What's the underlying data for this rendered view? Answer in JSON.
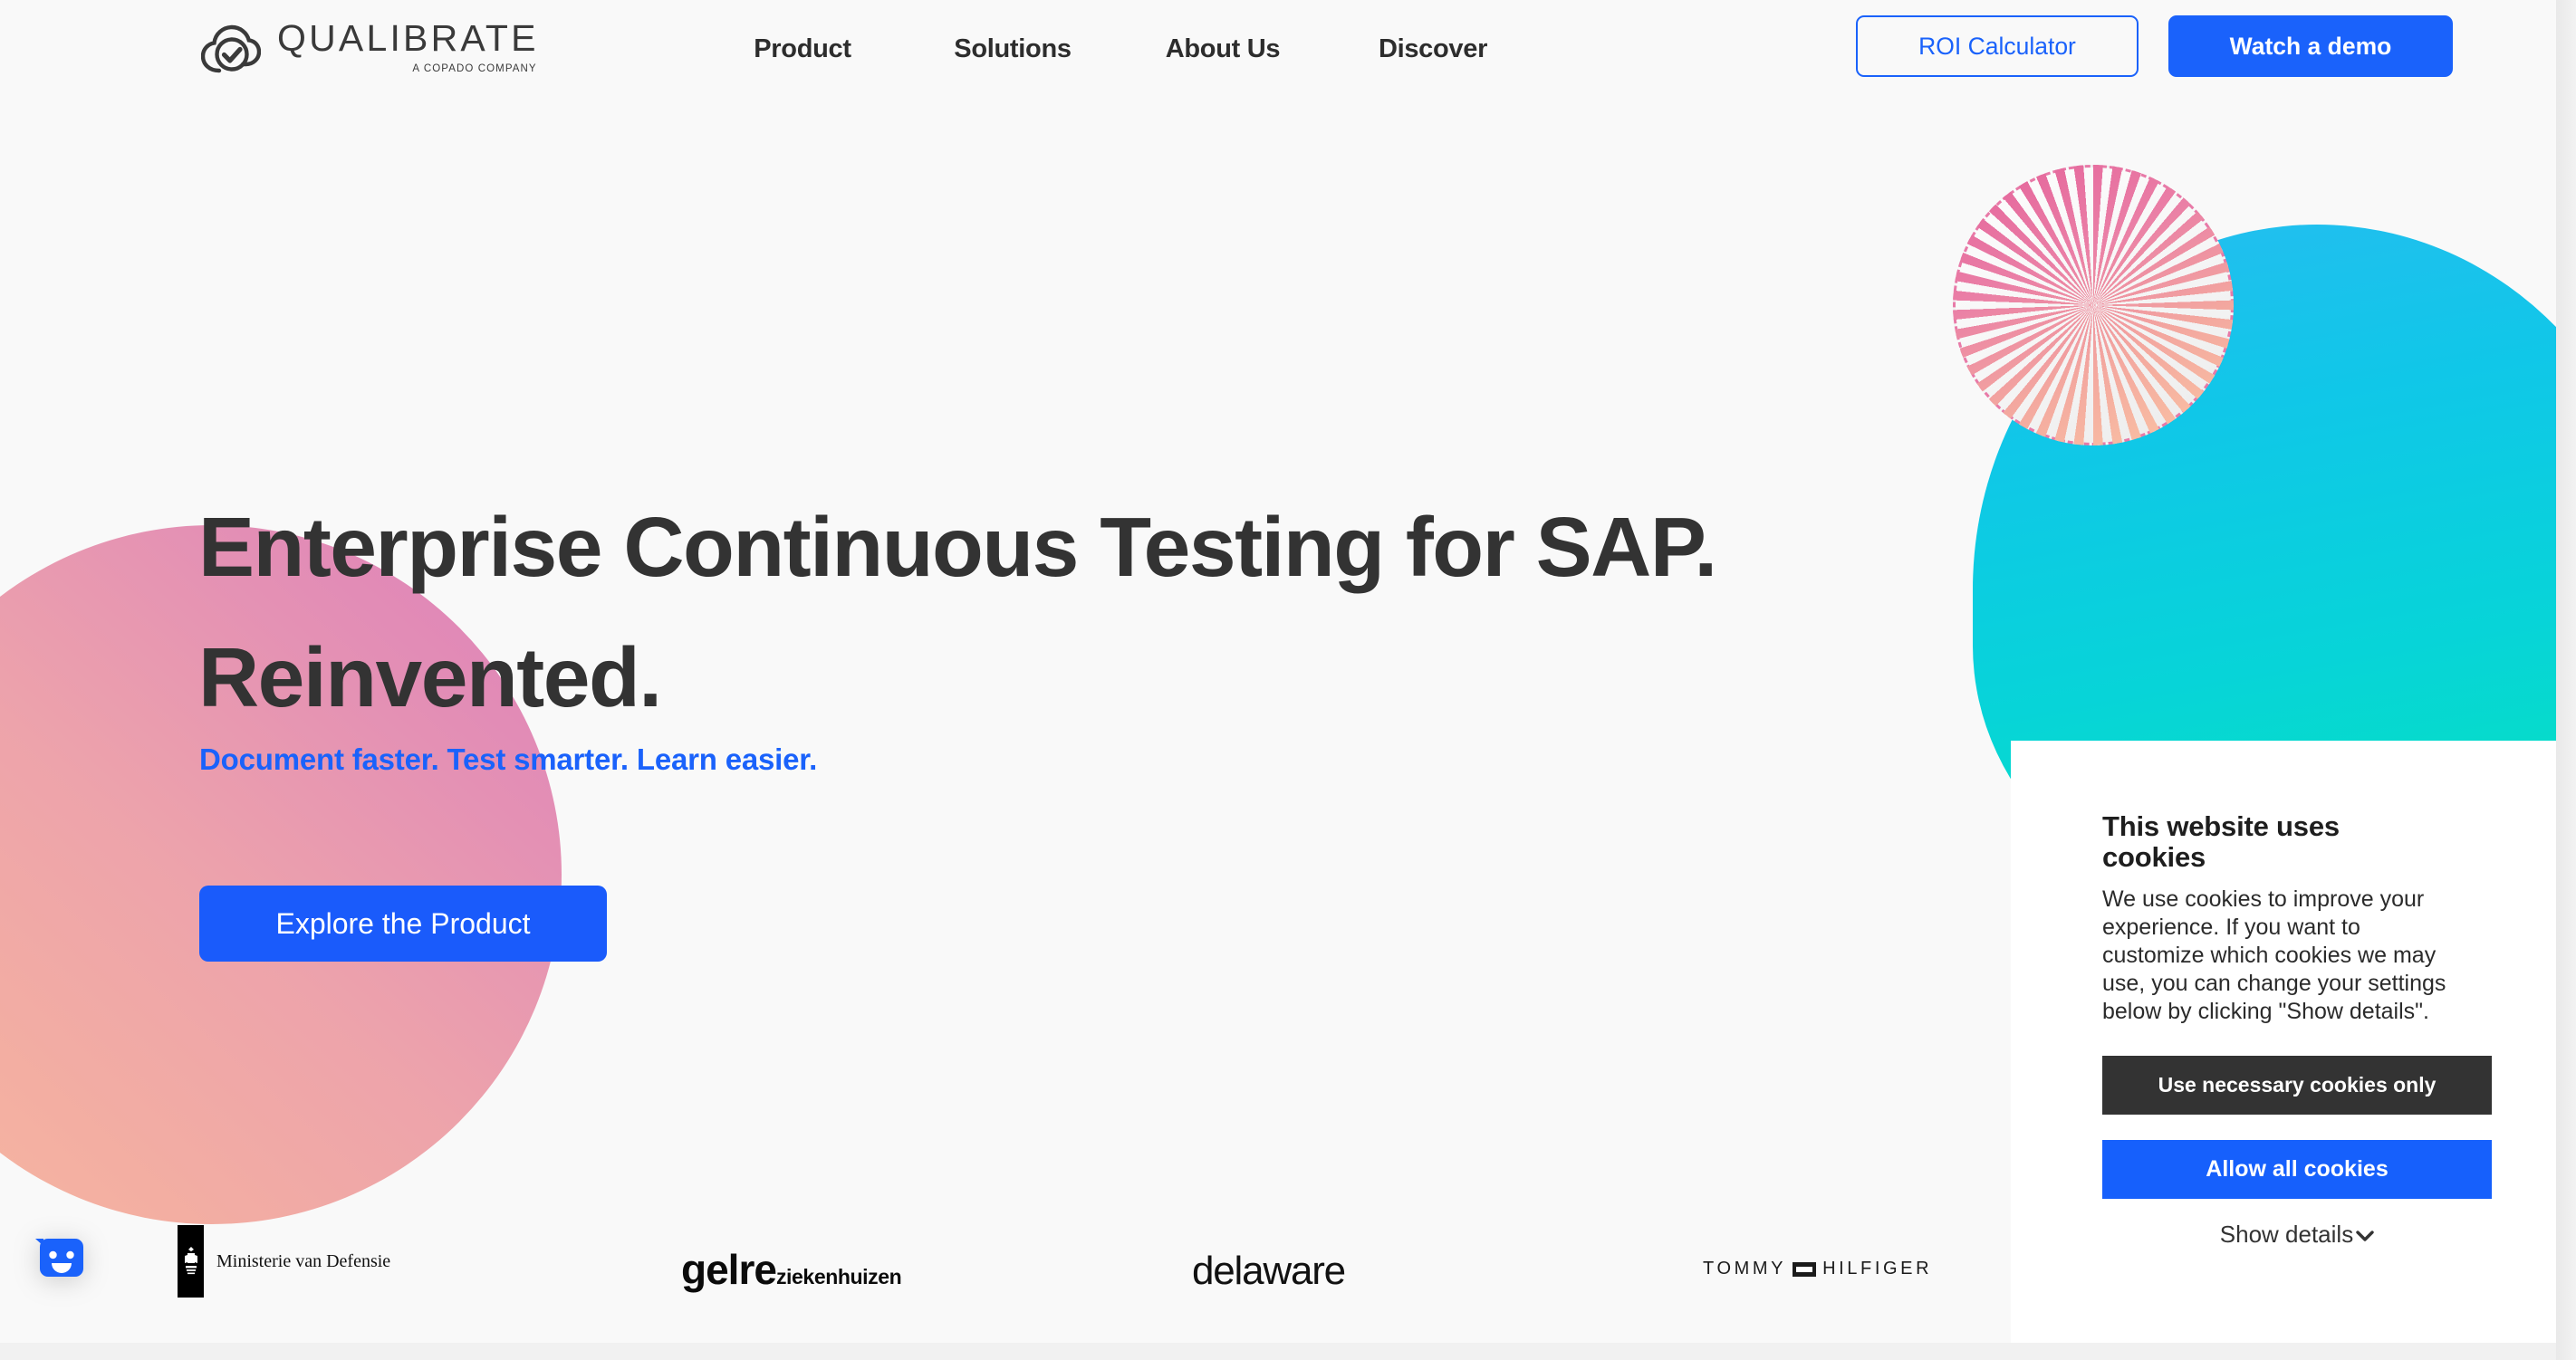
{
  "brand": {
    "logo_word": "QUALIBRATE",
    "logo_tagline": "A COPADO COMPANY",
    "logo_icon": "cloud-check-icon",
    "accent_blue": "#1a62fb",
    "dark": "#333333",
    "cyan_blob_from": "#25bdf0",
    "cyan_blob_to": "#05e2bd",
    "pink_blob_from": "#f7b9a0",
    "pink_blob_to": "#dd7fbb",
    "dashed_circle_stroke": "#e4619a"
  },
  "nav": {
    "items": [
      {
        "label": "Product"
      },
      {
        "label": "Solutions"
      },
      {
        "label": "About Us"
      },
      {
        "label": "Discover"
      }
    ],
    "roi_button": "ROI Calculator",
    "demo_button": "Watch a demo"
  },
  "hero": {
    "title": "Enterprise Continuous Testing for SAP. Reinvented.",
    "subtitle": "Document faster. Test smarter. Learn easier.",
    "cta": "Explore the Product"
  },
  "clients": {
    "defensie_label": "Ministerie van Defensie",
    "gelre_main": "gelre",
    "gelre_sub": "ziekenhuizen",
    "delaware": "delaware",
    "tommy_first": "TOMMY",
    "tommy_second": "HILFIGER"
  },
  "chat": {
    "icon": "chat-smiley-icon"
  },
  "cookies": {
    "title": "This website uses cookies",
    "body": "We use cookies to improve your experience. If you want to customize which cookies we may use, you can change your settings below by clicking \"Show details\".",
    "necessary_button": "Use necessary cookies only",
    "allow_all_button": "Allow all cookies",
    "show_details": "Show details",
    "chevron": "⌄"
  }
}
